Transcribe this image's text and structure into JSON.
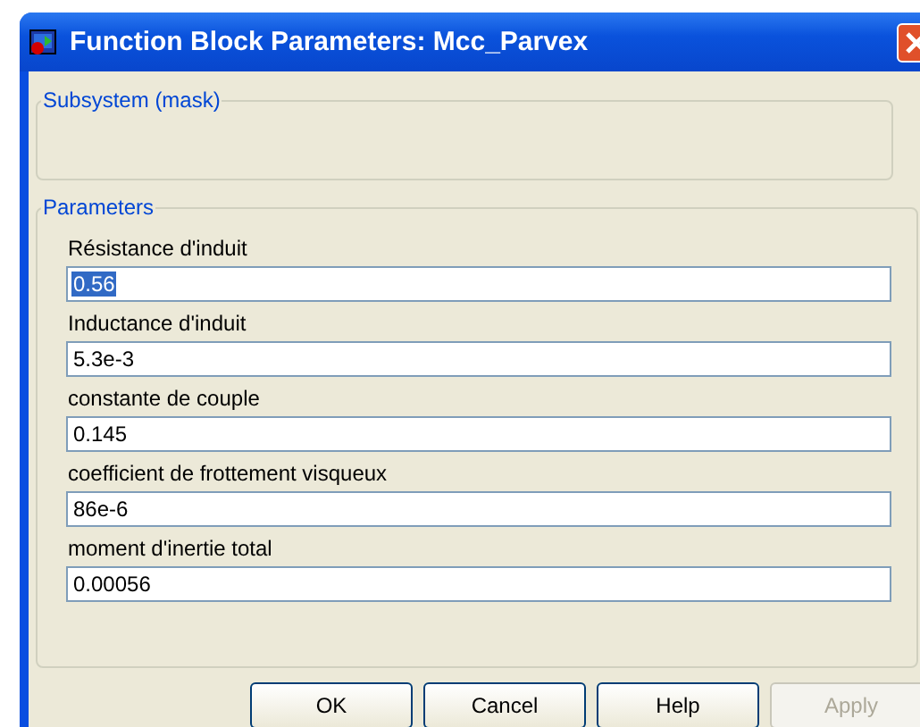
{
  "window": {
    "title": "Function Block Parameters: Mcc_Parvex"
  },
  "subsystem": {
    "legend": "Subsystem (mask)"
  },
  "parameters": {
    "legend": "Parameters",
    "fields": [
      {
        "label": "Résistance d'induit",
        "value": "0.56",
        "highlighted": true
      },
      {
        "label": "Inductance d'induit",
        "value": "5.3e-3",
        "highlighted": false
      },
      {
        "label": "constante de couple",
        "value": "0.145",
        "highlighted": false
      },
      {
        "label": "coefficient de frottement visqueux",
        "value": "86e-6",
        "highlighted": false
      },
      {
        "label": "moment d'inertie total",
        "value": "0.00056",
        "highlighted": false
      }
    ]
  },
  "buttons": [
    {
      "label": "OK",
      "disabled": false
    },
    {
      "label": "Cancel",
      "disabled": false
    },
    {
      "label": "Help",
      "disabled": false
    },
    {
      "label": "Apply",
      "disabled": true
    }
  ]
}
